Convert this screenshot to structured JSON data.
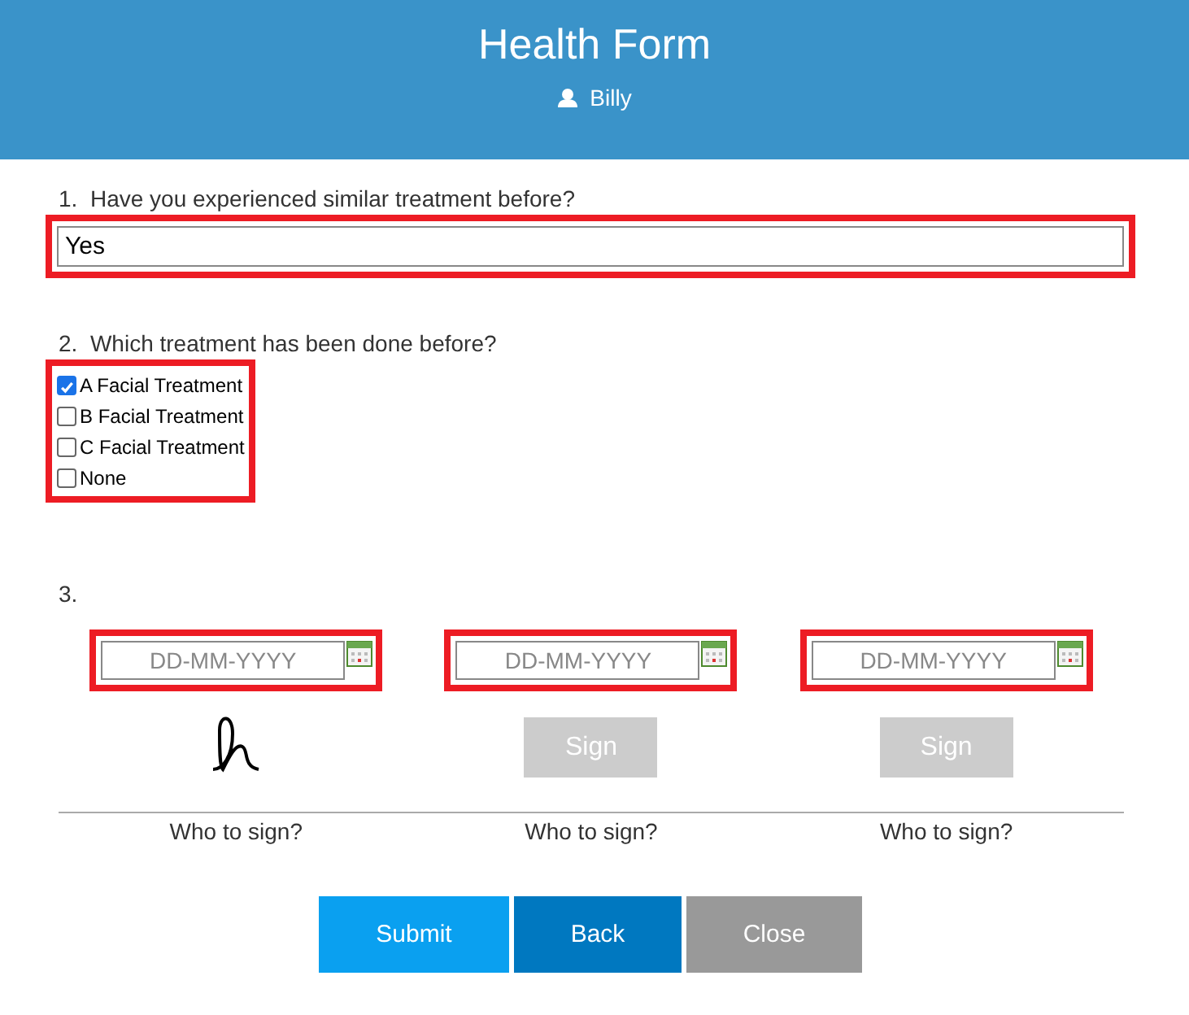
{
  "header": {
    "title": "Health Form",
    "user": "Billy"
  },
  "questions": [
    {
      "kind": "text",
      "number": "1.",
      "label": "Have you experienced similar treatment before?",
      "value": "Yes",
      "highlighted": true
    },
    {
      "kind": "checkboxes",
      "number": "2.",
      "label": "Which treatment has been done before?",
      "highlighted": true,
      "options": [
        {
          "label": "A Facial Treatment",
          "checked": true
        },
        {
          "label": "B Facial Treatment",
          "checked": false
        },
        {
          "label": "C Facial Treatment",
          "checked": false
        },
        {
          "label": "None",
          "checked": false
        }
      ]
    },
    {
      "kind": "signatures",
      "number": "3.",
      "signers": [
        {
          "placeholder": "DD-MM-YYYY",
          "highlighted": true,
          "signed": true,
          "caption": "Who to sign?"
        },
        {
          "placeholder": "DD-MM-YYYY",
          "highlighted": true,
          "signed": false,
          "sign_label": "Sign",
          "caption": "Who to sign?"
        },
        {
          "placeholder": "DD-MM-YYYY",
          "highlighted": true,
          "signed": false,
          "sign_label": "Sign",
          "caption": "Who to sign?"
        }
      ]
    }
  ],
  "buttons": [
    {
      "label": "Submit",
      "kind": "primary"
    },
    {
      "label": "Back",
      "kind": "secondary"
    },
    {
      "label": "Close",
      "kind": "neutral"
    }
  ]
}
